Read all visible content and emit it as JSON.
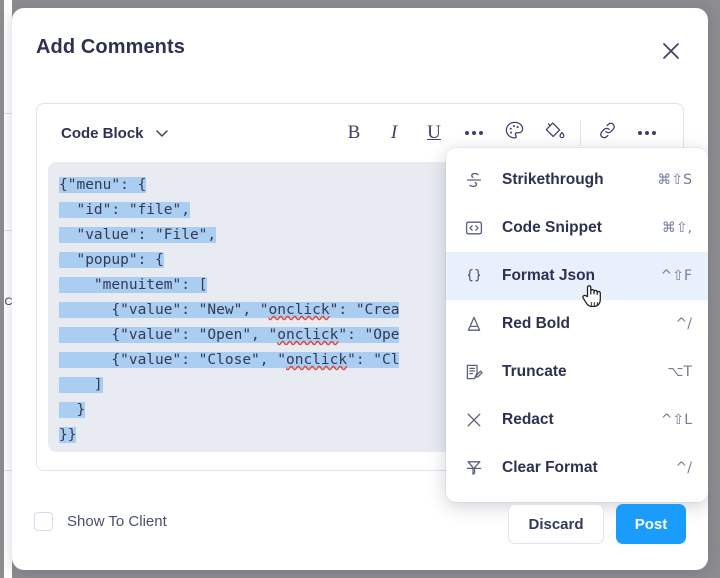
{
  "dialog": {
    "title": "Add Comments",
    "close_icon": "close-icon"
  },
  "editor": {
    "style_select": {
      "label": "Code Block",
      "chevron_icon": "chevron-down-icon"
    },
    "toolbar_left": [
      {
        "name": "bold-button",
        "label": "B",
        "icon": "bold-icon"
      },
      {
        "name": "italic-button",
        "label": "I",
        "icon": "italic-icon"
      },
      {
        "name": "underline-button",
        "label": "U",
        "icon": "underline-icon"
      },
      {
        "name": "more-formatting-button",
        "label": "",
        "icon": "ellipsis-icon"
      }
    ],
    "toolbar_right": [
      {
        "name": "text-color-button",
        "icon": "palette-icon"
      },
      {
        "name": "highlight-color-button",
        "icon": "paint-bucket-icon"
      },
      {
        "name": "insert-link-button",
        "icon": "link-icon"
      },
      {
        "name": "more-options-button",
        "icon": "ellipsis-icon"
      }
    ],
    "code": {
      "lines": [
        {
          "text": "{\"menu\": {",
          "selected": true
        },
        {
          "text": "  \"id\": \"file\",",
          "selected": true
        },
        {
          "text": "  \"value\": \"File\",",
          "selected": true
        },
        {
          "text": "  \"popup\": {",
          "selected": true
        },
        {
          "text": "    \"menuitem\": [",
          "selected": true
        },
        {
          "text": "      {\"value\": \"New\", \"onclick\": \"Crea",
          "selected": true,
          "misspelled": "onclick"
        },
        {
          "text": "      {\"value\": \"Open\", \"onclick\": \"Ope",
          "selected": true,
          "misspelled": "onclick"
        },
        {
          "text": "      {\"value\": \"Close\", \"onclick\": \"Cl",
          "selected": true,
          "misspelled": "onclick"
        },
        {
          "text": "    ]",
          "selected": true
        },
        {
          "text": "  }",
          "selected": true
        },
        {
          "text": "}}",
          "selected": true
        }
      ],
      "full_text": "{\"menu\": {\n  \"id\": \"file\",\n  \"value\": \"File\",\n  \"popup\": {\n    \"menuitem\": [\n      {\"value\": \"New\", \"onclick\": \"Crea\n      {\"value\": \"Open\", \"onclick\": \"Ope\n      {\"value\": \"Close\", \"onclick\": \"Cl\n    ]\n  }\n}}"
    }
  },
  "menu": {
    "items": [
      {
        "label": "Strikethrough",
        "shortcut": "⌘⇧S",
        "icon": "strikethrough-icon",
        "active": false
      },
      {
        "label": "Code Snippet",
        "shortcut": "⌘⇧,",
        "icon": "code-snippet-icon",
        "active": false
      },
      {
        "label": "Format Json",
        "shortcut": "^⇧F",
        "icon": "curly-braces-icon",
        "active": true
      },
      {
        "label": "Red Bold",
        "shortcut": "^/",
        "icon": "letter-a-icon",
        "active": false
      },
      {
        "label": "Truncate",
        "shortcut": "⌥T",
        "icon": "truncate-icon",
        "active": false
      },
      {
        "label": "Redact",
        "shortcut": "^⇧L",
        "icon": "cross-icon",
        "active": false
      },
      {
        "label": "Clear Format",
        "shortcut": "^/",
        "icon": "clear-format-icon",
        "active": false
      }
    ]
  },
  "footer": {
    "checkbox_label": "Show To Client",
    "checked": false,
    "discard_label": "Discard",
    "post_label": "Post"
  },
  "colors": {
    "accent": "#1a9cfc",
    "title": "#2e3151",
    "selection": "#aacdf2",
    "code_bg": "#e8ecf2",
    "menu_active": "#e7f0fb",
    "page_backdrop": "#8d8d90"
  },
  "cursor": {
    "icon": "pointing-hand-cursor"
  },
  "background": {
    "text": "iC"
  }
}
